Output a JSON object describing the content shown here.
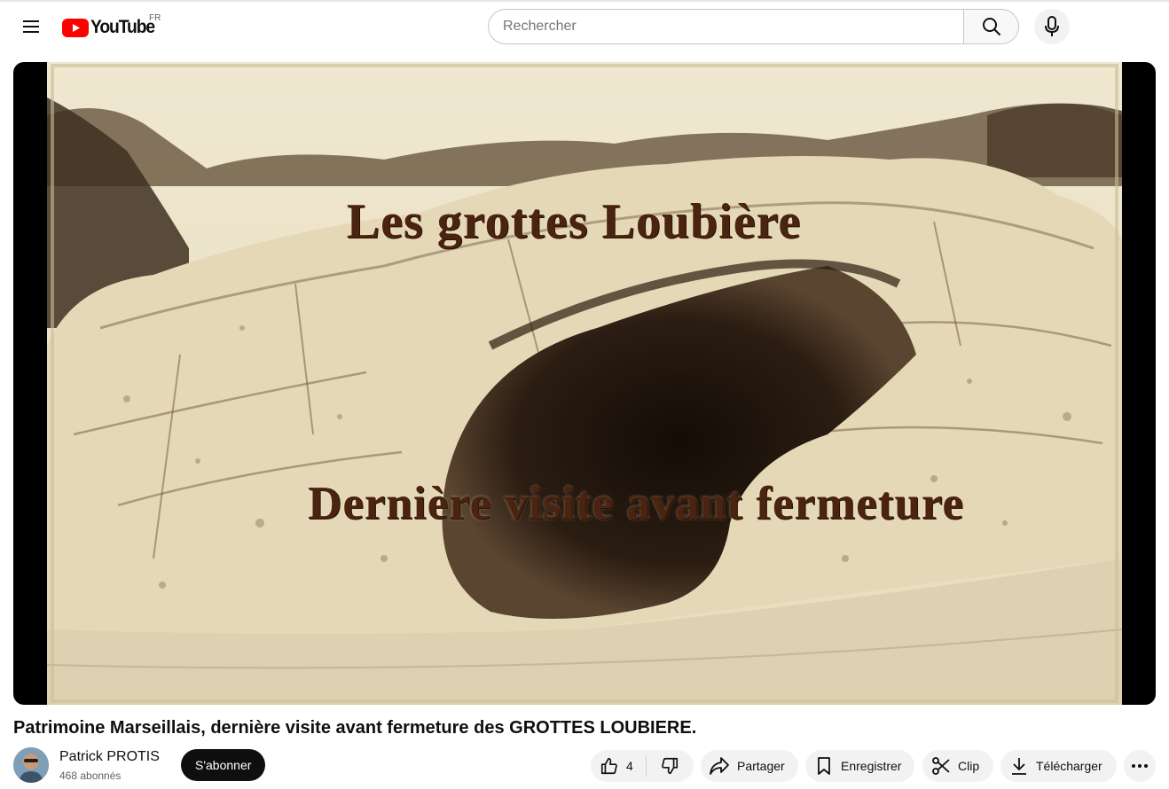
{
  "masthead": {
    "logo_text": "YouTube",
    "region_code": "FR",
    "search_placeholder": "Rechercher",
    "icons": [
      "menu-icon",
      "youtube-logo-icon",
      "search-icon",
      "microphone-icon"
    ]
  },
  "player": {
    "overlay_title_1": "Les grottes Loubière",
    "overlay_title_2": "Dernière visite avant fermeture"
  },
  "video": {
    "title": "Patrimoine Marseillais, dernière visite avant fermeture des GROTTES LOUBIERE."
  },
  "channel": {
    "name": "Patrick PROTIS",
    "subscribers": "468 abonnés",
    "subscribe_label": "S'abonner"
  },
  "actions": {
    "like_count": "4",
    "share_label": "Partager",
    "save_label": "Enregistrer",
    "clip_label": "Clip",
    "download_label": "Télécharger",
    "icons": [
      "thumbs-up-icon",
      "thumbs-down-icon",
      "share-icon",
      "bookmark-icon",
      "scissors-icon",
      "download-icon",
      "more-icon"
    ]
  },
  "colors": {
    "brand_red": "#ff0000",
    "subscribe_bg": "#0f0f0f",
    "pill_bg": "#f2f2f2",
    "overlay_text": "#4a2410"
  }
}
